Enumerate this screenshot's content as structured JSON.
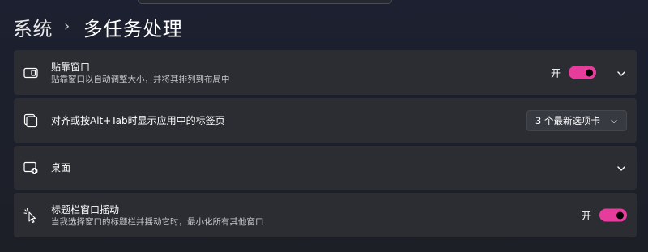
{
  "breadcrumb": {
    "parent": "系统",
    "separator": "›",
    "current": "多任务处理"
  },
  "settings": [
    {
      "title": "贴靠窗口",
      "description": "贴靠窗口以自动调整大小，并将其排列到布局中",
      "icon": "snap-window-icon",
      "toggle_label": "开",
      "toggle_on": true,
      "expandable": true
    },
    {
      "title": "对齐或按Alt+Tab时显示应用中的标签页",
      "icon": "stacked-windows-icon",
      "dropdown_value": "3 个最新选项卡"
    },
    {
      "title": "桌面",
      "icon": "desktop-add-icon",
      "expandable": true
    },
    {
      "title": "标题栏窗口摇动",
      "description": "当我选择窗口的标题栏并摇动它时，最小化所有其他窗口",
      "icon": "shake-cursor-icon",
      "toggle_label": "开",
      "toggle_on": true
    }
  ],
  "colors": {
    "accent": "#e63d9c",
    "card": "#2b2d33",
    "background": "#1d1f27"
  }
}
